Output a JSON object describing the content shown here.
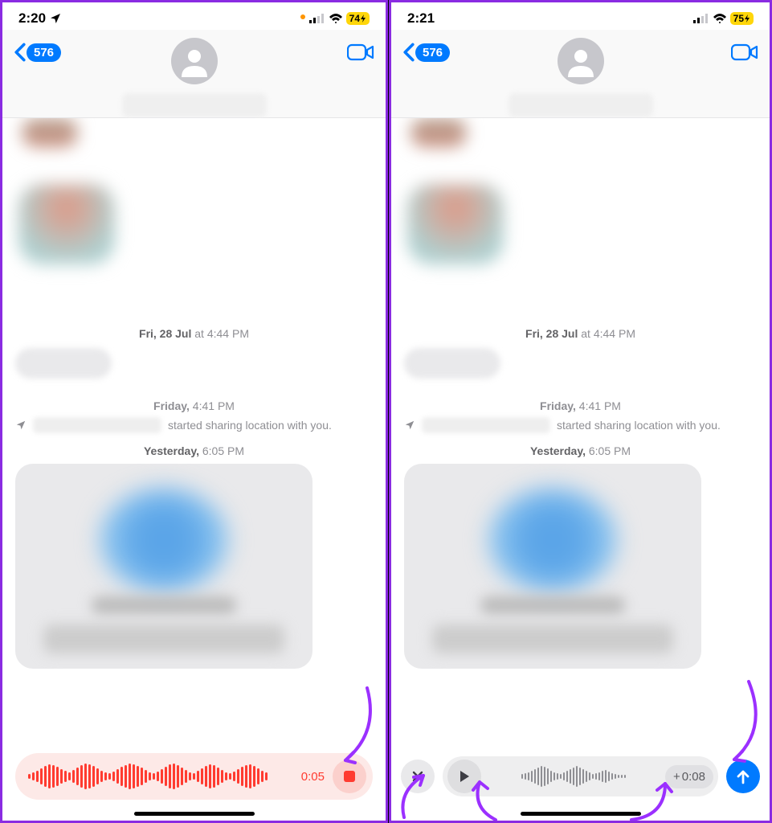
{
  "screens": {
    "left": {
      "status": {
        "time": "2:20",
        "battery": "74"
      },
      "header": {
        "back_count": "576"
      },
      "thread": {
        "date1_day": "Fri, 28 Jul",
        "date1_at": " at ",
        "date1_time": "4:44 PM",
        "loc_day": "Friday,",
        "loc_time": " 4:41 PM",
        "loc_msg_suffix": " started sharing location with you.",
        "date2_day": "Yesterday,",
        "date2_time": " 6:05 PM"
      },
      "recorder": {
        "elapsed": "0:05"
      }
    },
    "right": {
      "status": {
        "time": "2:21",
        "battery": "75"
      },
      "header": {
        "back_count": "576"
      },
      "thread": {
        "date1_day": "Fri, 28 Jul",
        "date1_at": " at ",
        "date1_time": "4:44 PM",
        "loc_day": "Friday,",
        "loc_time": " 4:41 PM",
        "loc_msg_suffix": " started sharing location with you.",
        "date2_day": "Yesterday,",
        "date2_time": " 6:05 PM"
      },
      "playback": {
        "duration_prefix": "+ ",
        "duration": "0:08"
      }
    }
  },
  "icons": {
    "location_arrow": "location-arrow-icon",
    "signal": "cellular-signal-icon",
    "wifi": "wifi-icon",
    "bolt": "charging-bolt-icon",
    "chevron_back": "chevron-left-icon",
    "person": "person-silhouette-icon",
    "video": "facetime-video-icon",
    "stop": "stop-recording-icon",
    "close": "close-x-icon",
    "play": "play-triangle-icon",
    "plus": "plus-icon",
    "send": "send-arrow-up-icon"
  }
}
